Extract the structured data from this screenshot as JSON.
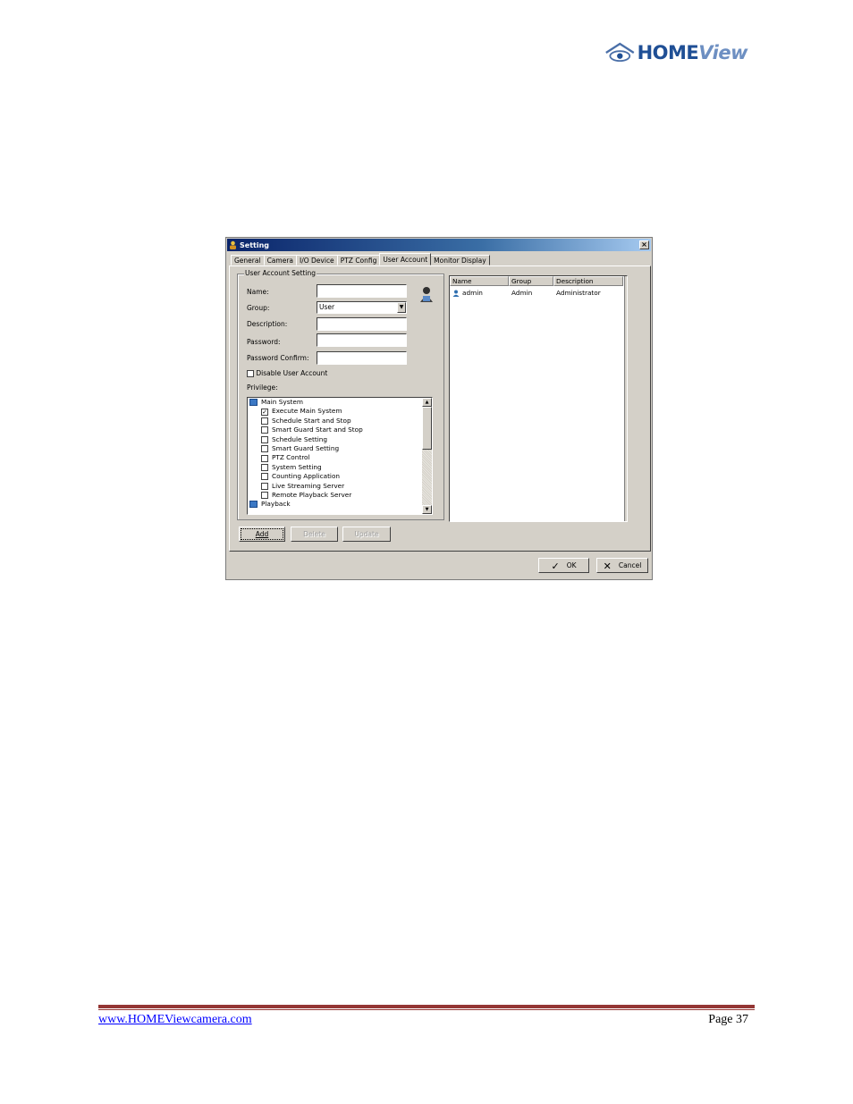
{
  "header": {
    "logo_text_bold": "HOME",
    "logo_text_italic": "View"
  },
  "window": {
    "title": "Setting",
    "close_glyph": "×",
    "tabs": [
      "General",
      "Camera",
      "I/O Device",
      "PTZ Config",
      "User Account",
      "Monitor Display"
    ],
    "active_tab": "User Account",
    "user_account_setting": {
      "legend": "User Account Setting",
      "name_label": "Name:",
      "name_value": "",
      "group_label": "Group:",
      "group_value": "User",
      "description_label": "Description:",
      "description_value": "",
      "password_label": "Password:",
      "password_value": "",
      "password_confirm_label": "Password Confirm:",
      "password_confirm_value": "",
      "disable_label": "Disable User Account",
      "disable_checked": false,
      "privilege_label": "Privilege:",
      "privileges": [
        {
          "label": "Main System",
          "type": "group"
        },
        {
          "label": "Execute Main System",
          "type": "item",
          "checked": true
        },
        {
          "label": "Schedule Start and Stop",
          "type": "item",
          "checked": false
        },
        {
          "label": "Smart Guard Start and Stop",
          "type": "item",
          "checked": false
        },
        {
          "label": "Schedule Setting",
          "type": "item",
          "checked": false
        },
        {
          "label": "Smart Guard Setting",
          "type": "item",
          "checked": false
        },
        {
          "label": "PTZ Control",
          "type": "item",
          "checked": false
        },
        {
          "label": "System Setting",
          "type": "item",
          "checked": false
        },
        {
          "label": "Counting Application",
          "type": "item",
          "checked": false
        },
        {
          "label": "Live Streaming Server",
          "type": "item",
          "checked": false
        },
        {
          "label": "Remote Playback Server",
          "type": "item",
          "checked": false
        },
        {
          "label": "Playback",
          "type": "group"
        }
      ]
    },
    "user_list": {
      "columns": [
        "Name",
        "Group",
        "Description"
      ],
      "rows": [
        {
          "name": "admin",
          "group": "Admin",
          "description": "Administrator"
        }
      ]
    },
    "buttons": {
      "add": "Add",
      "delete": "Delete",
      "update": "Update",
      "ok": "OK",
      "cancel": "Cancel"
    }
  },
  "footer": {
    "link": "www.HOMEViewcamera.com",
    "page": "Page 37",
    "rule_color": "#943634"
  }
}
